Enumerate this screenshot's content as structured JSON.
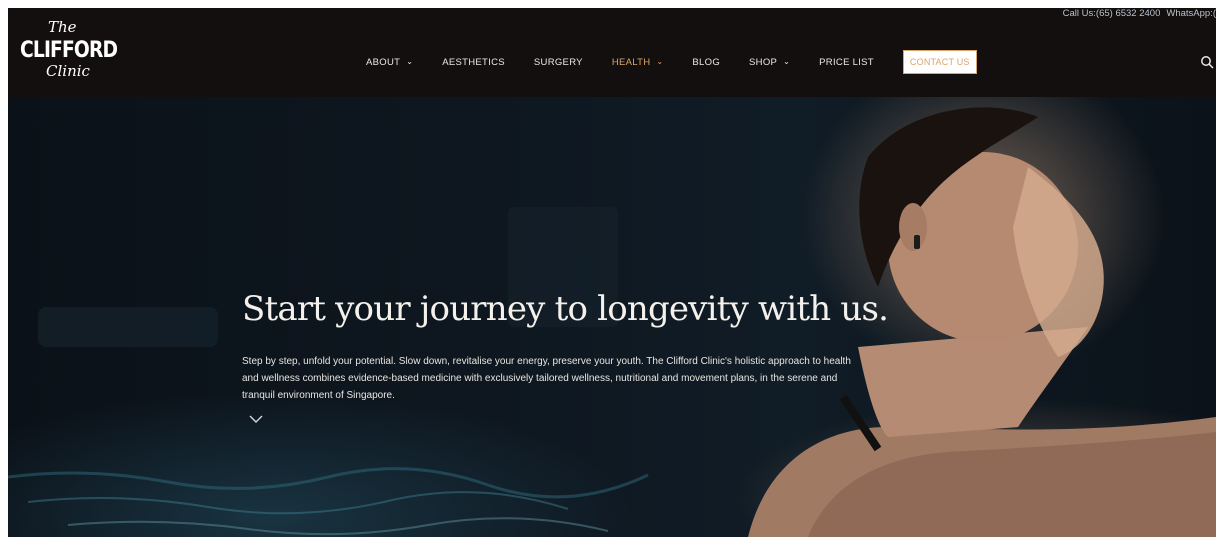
{
  "topbar": {
    "phone": "Call Us:(65) 6532 2400",
    "whatsapp": "WhatsApp:("
  },
  "logo": {
    "line1": "The",
    "line2": "CLIFFORD",
    "line3": "Clinic"
  },
  "nav": {
    "items": [
      {
        "label": "ABOUT",
        "dropdown": true
      },
      {
        "label": "AESTHETICS",
        "dropdown": false
      },
      {
        "label": "SURGERY",
        "dropdown": false
      },
      {
        "label": "HEALTH",
        "dropdown": true,
        "active": true
      },
      {
        "label": "BLOG",
        "dropdown": false
      },
      {
        "label": "SHOP",
        "dropdown": true
      },
      {
        "label": "PRICE LIST",
        "dropdown": false
      }
    ],
    "contact_label": "CONTACT US",
    "search_icon": "search-icon",
    "chevron_icon": "chevron-down-icon"
  },
  "hero": {
    "title": "Start your journey to longevity with us.",
    "text": "Step by step, unfold your potential. Slow down, revitalise your energy, preserve your youth. The Clifford Clinic's holistic approach to health and wellness combines evidence-based medicine with exclusively tailored wellness, nutritional and movement plans, in the serene and tranquil environment of Singapore.",
    "scroll_icon": "chevron-down-icon"
  },
  "colors": {
    "header_bg": "#140f0f",
    "accent": "#d9a56b",
    "text_light": "#f4f1ec"
  }
}
